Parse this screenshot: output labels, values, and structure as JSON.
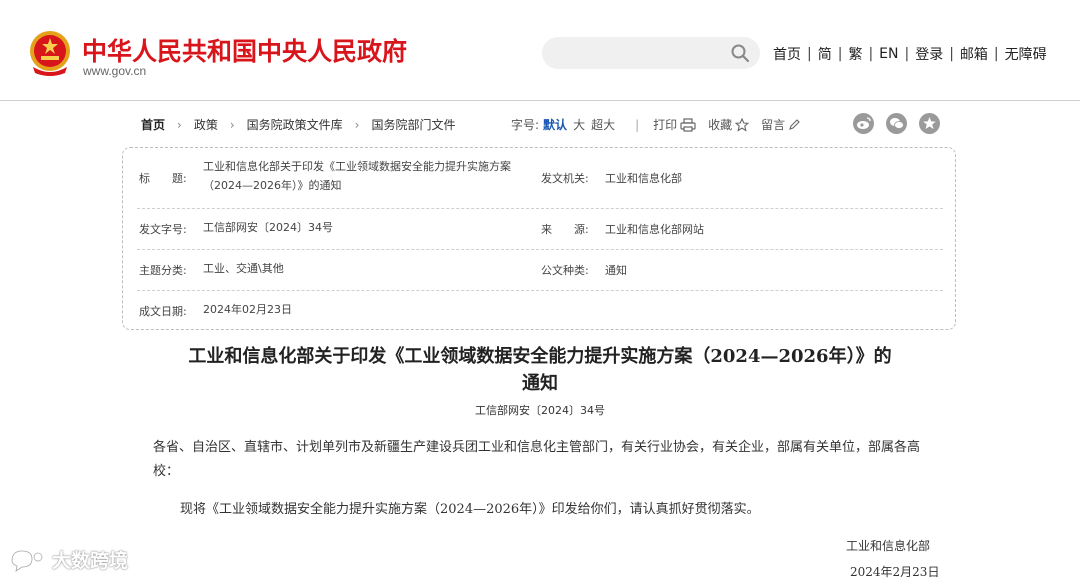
{
  "header": {
    "site_title": "中华人民共和国中央人民政府",
    "site_url": "www.gov.cn",
    "search_placeholder": "",
    "nav": [
      "首页",
      "简",
      "繁",
      "EN",
      "登录",
      "邮箱",
      "无障碍"
    ],
    "colors": {
      "brand_red": "#d8151b",
      "link_blue": "#1a56b4"
    }
  },
  "breadcrumb": [
    "首页",
    "政策",
    "国务院政策文件库",
    "国务院部门文件"
  ],
  "toolbar": {
    "font_size_label": "字号:",
    "font_default": "默认",
    "font_large": "大",
    "font_xlarge": "超大",
    "print": "打印",
    "favorite": "收藏",
    "comment": "留言",
    "share_icons": [
      "weibo-icon",
      "wechat-icon",
      "star-share-icon"
    ]
  },
  "info": {
    "title_label": "标　　题:",
    "title_line1": "工业和信息化部关于印发《工业领域数据安全能力提升实施方案",
    "title_line2": "（2024—2026年）》的通知",
    "issuer_label": "发文机关:",
    "issuer": "工业和信息化部",
    "docno_label": "发文字号:",
    "docno": "工信部网安〔2024〕34号",
    "source_label": "来　　源:",
    "source": "工业和信息化部网站",
    "topic_label": "主题分类:",
    "topic": "工业、交通\\其他",
    "type_label": "公文种类:",
    "type": "通知",
    "date_label": "成文日期:",
    "date": "2024年02月23日"
  },
  "article": {
    "title_line1": "工业和信息化部关于印发《工业领域数据安全能力提升实施方案（2024—2026年）》的",
    "title_line2": "通知",
    "doc_number": "工信部网安〔2024〕34号",
    "para1": "各省、自治区、直辖市、计划单列市及新疆生产建设兵团工业和信息化主管部门，有关行业协会，有关企业，部属有关单位，部属各高校：",
    "para2": "现将《工业领域数据安全能力提升实施方案（2024—2026年）》印发给你们，请认真抓好贯彻落实。",
    "sign_org": "工业和信息化部",
    "sign_date": "2024年2月23日"
  },
  "watermark": "大数跨境"
}
